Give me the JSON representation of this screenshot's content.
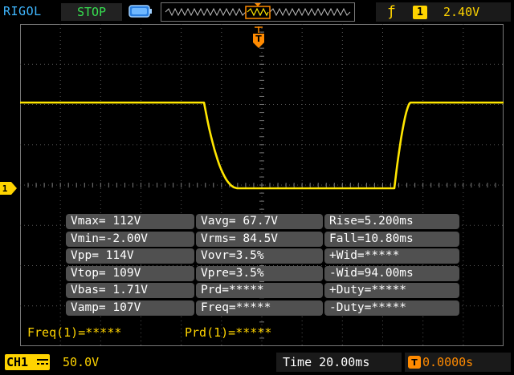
{
  "header": {
    "brand": "RIGOL",
    "run_status": "STOP",
    "trigger": {
      "edge_icon": "rising-edge-icon",
      "channel": "1",
      "level": "2.40V"
    }
  },
  "channel": {
    "label": "CH1",
    "marker": "1",
    "scale": "50.0V"
  },
  "timebase": {
    "time": "Time 20.00ms",
    "offset": "0.0000s"
  },
  "measurements": [
    [
      "Vmax= 112V",
      "Vavg= 67.7V",
      "Rise=5.200ms"
    ],
    [
      "Vmin=-2.00V",
      "Vrms= 84.5V",
      "Fall=10.80ms"
    ],
    [
      "Vpp= 114V",
      "Vovr=3.5%",
      "+Wid=*****"
    ],
    [
      "Vtop= 109V",
      "Vpre=3.5%",
      "-Wid=94.00ms"
    ],
    [
      "Vbas= 1.71V",
      "Prd=*****",
      "+Duty=*****"
    ],
    [
      "Vamp= 107V",
      "Freq=*****",
      "-Duty=*****"
    ]
  ],
  "counters": {
    "freq": "Freq(1)=*****",
    "prd": "Prd(1)=*****"
  },
  "colors": {
    "trace": "#ffe600",
    "brand": "#3fb7ff",
    "status": "#37e050",
    "trigger": "#ff8a00"
  }
}
